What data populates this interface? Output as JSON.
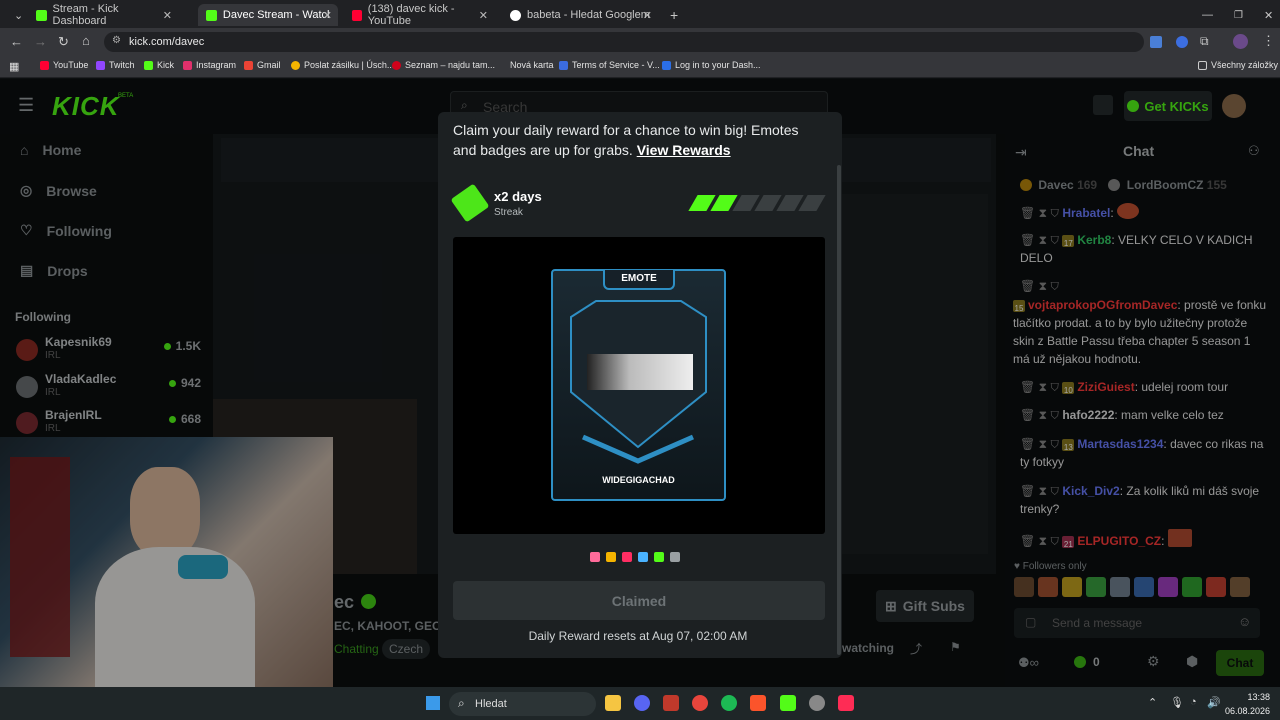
{
  "browser": {
    "tabs": [
      {
        "title": "Stream - Kick Dashboard",
        "active": false
      },
      {
        "title": "Davec Stream - Watch Live on K",
        "active": true
      },
      {
        "title": "(138) davec kick - YouTube",
        "active": false
      },
      {
        "title": "babeta - Hledat Googlem",
        "active": false
      }
    ],
    "url": "kick.com/davec",
    "bookmarks": [
      "YouTube",
      "Twitch",
      "Kick",
      "Instagram",
      "Gmail",
      "Poslat zásilku | Úsch...",
      "Seznam – najdu tam...",
      "Nová karta",
      "Terms of Service - V...",
      "Log in to your Dash..."
    ],
    "all_bookmarks": "Všechny záložky"
  },
  "kick": {
    "logo": "KICK",
    "logo_beta": "BETA",
    "search_placeholder": "Search",
    "get_kicks": "Get KICKs",
    "nav": [
      {
        "label": "Home",
        "icon": "home-icon"
      },
      {
        "label": "Browse",
        "icon": "compass-icon"
      },
      {
        "label": "Following",
        "icon": "heart-icon"
      },
      {
        "label": "Drops",
        "icon": "drops-icon"
      }
    ],
    "following_heading": "Following",
    "following": [
      {
        "name": "Kapesnik69",
        "category": "IRL",
        "viewers": "1.5K"
      },
      {
        "name": "VladaKadlec",
        "category": "IRL",
        "viewers": "942"
      },
      {
        "name": "BrajenIRL",
        "category": "IRL",
        "viewers": "668"
      }
    ],
    "stream": {
      "streamer_partial": "ec",
      "tags_partial": "EC, KAHOOT, GEOM",
      "category_partial": "Chatting",
      "language": "Czech",
      "gift_subs": "Gift Subs",
      "watching_partial": "watching"
    }
  },
  "chat": {
    "title": "Chat",
    "top_gifters": [
      {
        "name": "Davec",
        "count": "169"
      },
      {
        "name": "LordBoomCZ",
        "count": "155"
      }
    ],
    "messages": [
      {
        "user": "Hrabatel",
        "text": ":",
        "color": "#6b7cff",
        "badge": ""
      },
      {
        "user": "Kerb8",
        "text": ": VELKY CELO V KADICH DELO",
        "color": "#33cc66",
        "badge": "17"
      },
      {
        "user": "vojtaprokopOGfromDavec",
        "text": ": prostě ve fonku tlačítko prodat. a to by bylo užitečny protože skin z Battle Passu třeba chapter 5 season 1 má už nějakou hodnotu.",
        "color": "#ff3b3b",
        "badge": "15"
      },
      {
        "user": "ZiziGuiest",
        "text": ": udelej room tour",
        "color": "#ff3b3b",
        "badge": "10"
      },
      {
        "user": "hafo2222",
        "text": ": mam velke celo tez",
        "color": "#e6e6e6",
        "badge": ""
      },
      {
        "user": "Martasdas1234",
        "text": ": davec co rikas na ty fotkyy",
        "color": "#6b7cff",
        "badge": "13"
      },
      {
        "user": "Kick_Div2",
        "text": ": Za kolik liků mi dáš svoje trenky?",
        "color": "#6b7cff",
        "badge": ""
      },
      {
        "user": "ELPUGITO_CZ",
        "text": ":",
        "color": "#ff3b3b",
        "badge": "21"
      }
    ],
    "followers_only": "Followers only",
    "input_placeholder": "Send a message",
    "kicks_count": "0",
    "send_label": "Chat"
  },
  "modal": {
    "intro": "Claim your daily reward for a chance to win big! Emotes and badges are up for grabs.",
    "view_rewards": "View Rewards",
    "streak_days": "x2 days",
    "streak_label": "Streak",
    "streak_filled": 2,
    "streak_total": 6,
    "card_type": "EMOTE",
    "card_name": "WIDEGIGACHAD",
    "color_dots": [
      "#ff6b9a",
      "#f5b400",
      "#ff2e63",
      "#4ab3ff",
      "#53fc18",
      "#9aa0a3"
    ],
    "claimed_label": "Claimed",
    "reset_text": "Daily Reward resets at Aug 07, 02:00 AM",
    "accent": "#53fc18"
  },
  "taskbar": {
    "search_placeholder": "Hledat",
    "time": "13:38",
    "date": "06.08.2026"
  }
}
